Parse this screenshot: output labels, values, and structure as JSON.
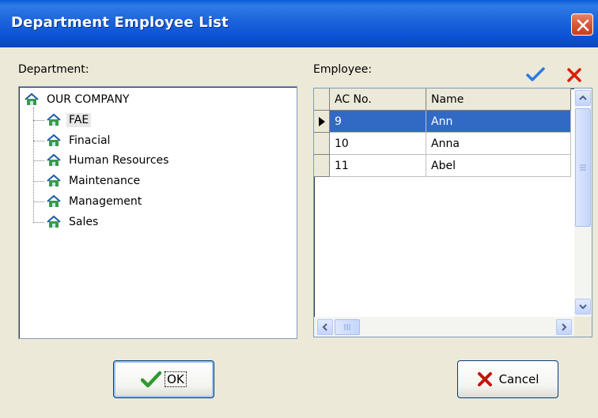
{
  "window": {
    "title": "Department Employee List"
  },
  "department": {
    "label": "Department:",
    "root": "OUR COMPANY",
    "items": [
      "FAE",
      "Finacial",
      "Human Resources",
      "Maintenance",
      "Management",
      "Sales"
    ],
    "selected": "FAE"
  },
  "employee": {
    "label": "Employee:",
    "columns": [
      "AC No.",
      "Name"
    ],
    "rows": [
      {
        "ac": "9",
        "name": "Ann"
      },
      {
        "ac": "10",
        "name": "Anna"
      },
      {
        "ac": "11",
        "name": "Abel"
      }
    ],
    "selected_row": 0
  },
  "buttons": {
    "ok": "OK",
    "cancel": "Cancel"
  },
  "colors": {
    "title_bar": "#0a51d3",
    "selection": "#316ac5",
    "check": "#2a7be0",
    "cross": "#d81e05"
  }
}
